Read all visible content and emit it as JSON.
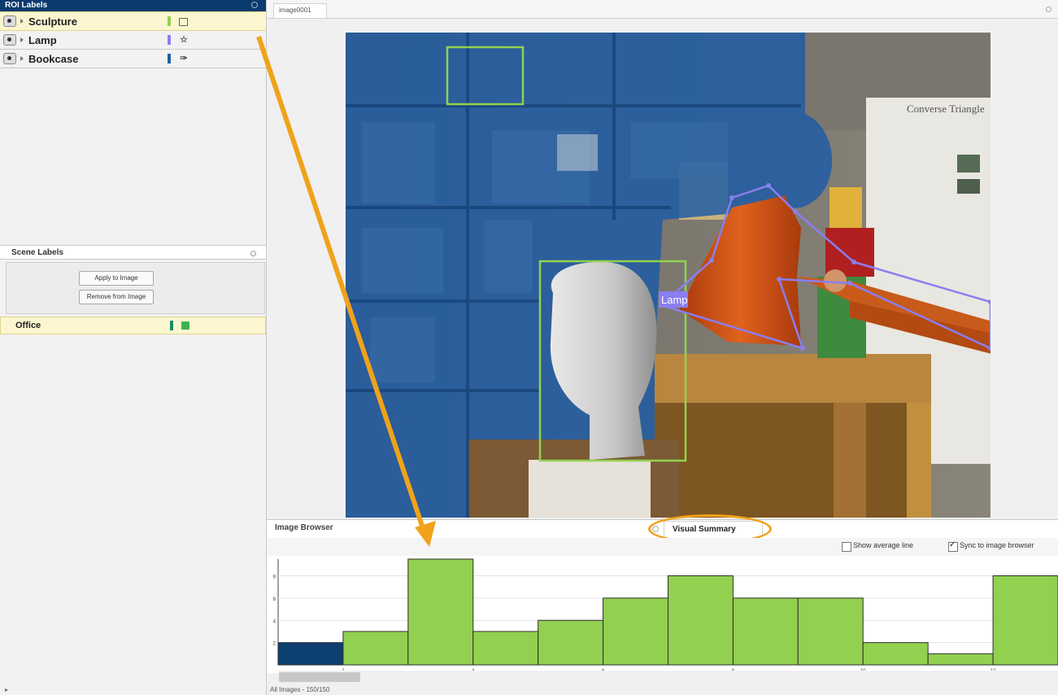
{
  "roi_panel": {
    "title": "ROI Labels",
    "items": [
      {
        "label": "Sculpture",
        "color": "#93d14f",
        "shape": "rectangle-icon"
      },
      {
        "label": "Lamp",
        "color": "#8c7ef2",
        "shape": "polygon-icon"
      },
      {
        "label": "Bookcase",
        "color": "#1f5fa0",
        "shape": "pixel-label-icon"
      }
    ]
  },
  "scene_panel": {
    "title": "Scene Labels",
    "apply_button": "Apply to Image",
    "remove_button": "Remove from Image",
    "items": [
      {
        "label": "Office",
        "color": "#1a8a6a"
      }
    ]
  },
  "document": {
    "tab": "image0001"
  },
  "image_annotation": {
    "lamp_tag": "Lamp"
  },
  "bottom_tabs": {
    "browser": "Image Browser",
    "summary": "Visual Summary"
  },
  "options": {
    "show_average": "Show average line",
    "sync": "Sync to image browser",
    "sync_checked": true,
    "show_average_checked": false
  },
  "status": {
    "text": "All Images - 150/150"
  },
  "chart_data": {
    "type": "bar",
    "yticks": [
      "8",
      "6",
      "4",
      "2"
    ],
    "xticks": [
      "2",
      "4",
      "6",
      "8",
      "10",
      "12"
    ],
    "ylim": [
      0,
      9.5
    ],
    "values": [
      2,
      3,
      9.5,
      3,
      4,
      6,
      8,
      6,
      6,
      2,
      1,
      8
    ],
    "highlight_index": 0,
    "colors": {
      "bar": "#92d050",
      "highlight": "#0d3f70"
    }
  }
}
